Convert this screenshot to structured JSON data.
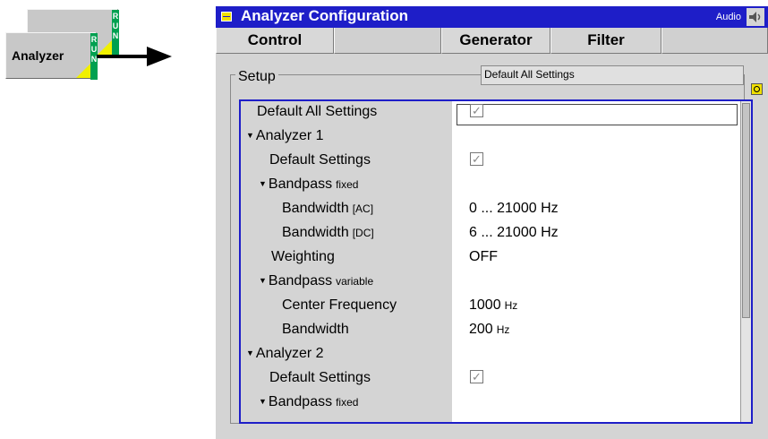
{
  "softkeys": {
    "front_label": "Analyzer",
    "run_text": "R U N"
  },
  "window": {
    "title": "Analyzer Configuration",
    "mode": "Audio",
    "tabs": [
      "Control",
      "",
      "Generator",
      "Filter",
      ""
    ]
  },
  "setup": {
    "group_label": "Setup",
    "context_value": "Default All Settings",
    "rows": [
      {
        "label": "Default All Settings",
        "checkbox": true
      },
      {
        "label": "Analyzer 1",
        "expander": true
      },
      {
        "label": "Default Settings",
        "checkbox": true
      },
      {
        "label": "Bandpass",
        "sub": "fixed",
        "expander": true
      },
      {
        "label": "Bandwidth",
        "sub": "[AC]",
        "value": "0 ... 21000 Hz"
      },
      {
        "label": "Bandwidth",
        "sub": "[DC]",
        "value": "6 ... 21000 Hz"
      },
      {
        "label": "Weighting",
        "value": "OFF"
      },
      {
        "label": "Bandpass",
        "sub": "variable",
        "expander": true
      },
      {
        "label": "Center Frequency",
        "value": "1000",
        "unit": "Hz"
      },
      {
        "label": "Bandwidth",
        "value": "200",
        "unit": "Hz"
      },
      {
        "label": "Analyzer 2",
        "expander": true
      },
      {
        "label": "Default Settings",
        "checkbox": true
      },
      {
        "label": "Bandpass",
        "sub": "fixed",
        "expander": true
      }
    ]
  },
  "icons": {
    "expander": "triangle-down-icon",
    "checkmark": "checkmark-icon"
  },
  "colors": {
    "title_bar": "#1e1ec8",
    "run_indicator": "#00a050",
    "accent_yellow": "#f0e000"
  }
}
